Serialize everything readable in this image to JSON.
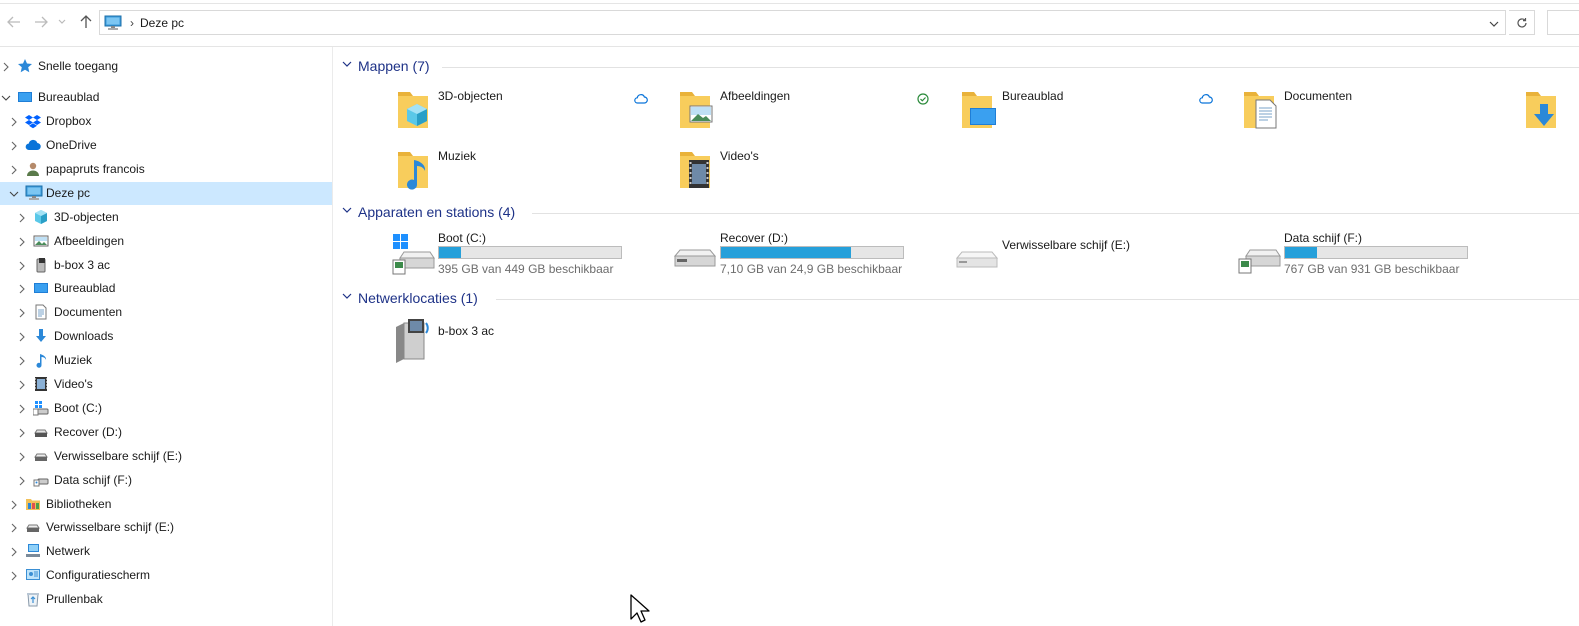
{
  "address_bar": {
    "back_label": "Terug",
    "forward_label": "Vooruit",
    "up_label": "Omhoog",
    "breadcrumb": "Deze pc"
  },
  "nav_tree": [
    {
      "label": "Snelle toegang",
      "icon": "star-icon",
      "level": 0,
      "expandable": true,
      "expanded": false
    },
    {
      "label": "Bureaublad",
      "icon": "desktop-icon",
      "level": 0,
      "expandable": true,
      "expanded": true
    },
    {
      "label": "Dropbox",
      "icon": "dropbox-icon",
      "level": 1,
      "expandable": true,
      "expanded": false
    },
    {
      "label": "OneDrive",
      "icon": "cloud-icon",
      "level": 1,
      "expandable": true,
      "expanded": false
    },
    {
      "label": "papapruts francois",
      "icon": "user-icon",
      "level": 1,
      "expandable": true,
      "expanded": false
    },
    {
      "label": "Deze pc",
      "icon": "computer-icon",
      "level": 1,
      "expandable": true,
      "expanded": true,
      "selected": true
    },
    {
      "label": "3D-objecten",
      "icon": "cube-icon",
      "level": 2,
      "expandable": true,
      "expanded": false
    },
    {
      "label": "Afbeeldingen",
      "icon": "pictures-icon",
      "level": 2,
      "expandable": true,
      "expanded": false
    },
    {
      "label": "b-box 3 ac",
      "icon": "media-device-icon",
      "level": 2,
      "expandable": true,
      "expanded": false
    },
    {
      "label": "Bureaublad",
      "icon": "desktop-icon",
      "level": 2,
      "expandable": true,
      "expanded": false
    },
    {
      "label": "Documenten",
      "icon": "document-icon",
      "level": 2,
      "expandable": true,
      "expanded": false
    },
    {
      "label": "Downloads",
      "icon": "download-icon",
      "level": 2,
      "expandable": true,
      "expanded": false
    },
    {
      "label": "Muziek",
      "icon": "music-icon",
      "level": 2,
      "expandable": true,
      "expanded": false
    },
    {
      "label": "Video's",
      "icon": "video-icon",
      "level": 2,
      "expandable": true,
      "expanded": false
    },
    {
      "label": "Boot (C:)",
      "icon": "system-drive-icon",
      "level": 2,
      "expandable": true,
      "expanded": false
    },
    {
      "label": "Recover (D:)",
      "icon": "drive-icon",
      "level": 2,
      "expandable": true,
      "expanded": false
    },
    {
      "label": "Verwisselbare schijf (E:)",
      "icon": "removable-drive-icon",
      "level": 2,
      "expandable": true,
      "expanded": false
    },
    {
      "label": "Data schijf (F:)",
      "icon": "shared-drive-icon",
      "level": 2,
      "expandable": true,
      "expanded": false
    },
    {
      "label": "Bibliotheken",
      "icon": "library-icon",
      "level": 1,
      "expandable": true,
      "expanded": false
    },
    {
      "label": "Verwisselbare schijf (E:)",
      "icon": "removable-drive-icon",
      "level": 1,
      "expandable": true,
      "expanded": false
    },
    {
      "label": "Netwerk",
      "icon": "network-icon",
      "level": 1,
      "expandable": true,
      "expanded": false
    },
    {
      "label": "Configuratiescherm",
      "icon": "control-panel-icon",
      "level": 1,
      "expandable": true,
      "expanded": false
    },
    {
      "label": "Prullenbak",
      "icon": "recycle-bin-icon",
      "level": 1,
      "expandable": false,
      "expanded": false
    }
  ],
  "content": {
    "folders_header": "Mappen (7)",
    "folders": [
      {
        "name": "3D-objecten",
        "icon": "folder-3d-icon",
        "status": "cloud-icon"
      },
      {
        "name": "Afbeeldingen",
        "icon": "folder-pictures-icon",
        "status": "synced-check-icon"
      },
      {
        "name": "Bureaublad",
        "icon": "folder-desktop-icon",
        "status": "cloud-icon"
      },
      {
        "name": "Documenten",
        "icon": "folder-documents-icon",
        "status": ""
      },
      {
        "name": "",
        "icon": "folder-downloads-icon",
        "status": ""
      },
      {
        "name": "Muziek",
        "icon": "folder-music-icon",
        "status": ""
      },
      {
        "name": "Video's",
        "icon": "folder-videos-icon",
        "status": ""
      }
    ],
    "devices_header": "Apparaten en stations (4)",
    "devices": [
      {
        "name": "Boot (C:)",
        "icon": "system-drive-icon",
        "used_fraction": 0.12,
        "free_text": "395 GB van 449 GB beschikbaar"
      },
      {
        "name": "Recover (D:)",
        "icon": "drive-icon",
        "used_fraction": 0.715,
        "free_text": "7,10 GB van 24,9 GB beschikbaar"
      },
      {
        "name": "Verwisselbare schijf (E:)",
        "icon": "removable-drive-icon",
        "used_fraction": null,
        "free_text": ""
      },
      {
        "name": "Data schijf (F:)",
        "icon": "shared-drive-icon",
        "used_fraction": 0.176,
        "free_text": "767 GB van 931 GB beschikbaar"
      }
    ],
    "network_header": "Netwerklocaties (1)",
    "network": [
      {
        "name": "b-box 3 ac",
        "icon": "media-server-icon"
      }
    ]
  },
  "colors": {
    "selection": "#cce8ff",
    "group_header": "#1e3287",
    "usage_bar": "#26a0da",
    "folder_yellow": "#f8cd5c"
  }
}
